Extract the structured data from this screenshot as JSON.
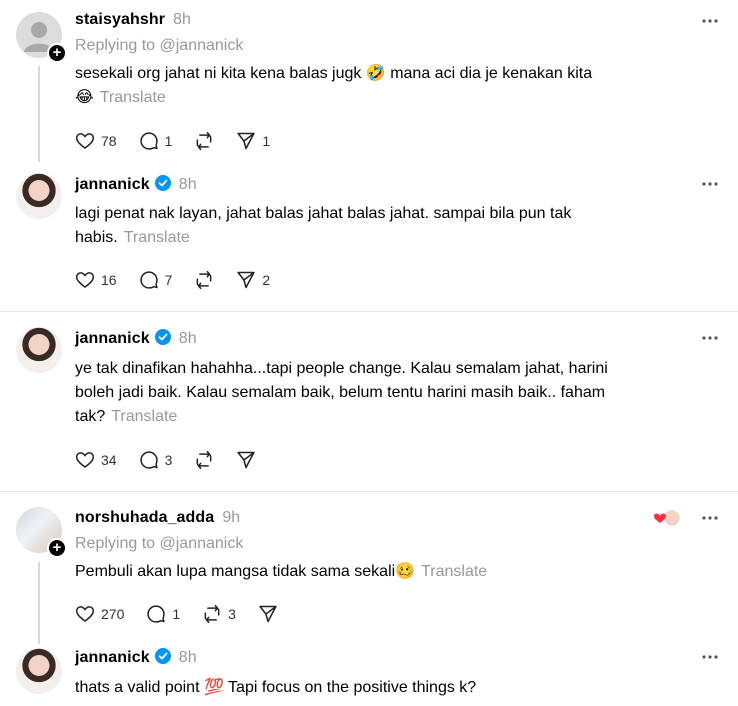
{
  "posts": [
    {
      "username": "staisyahshr",
      "time": "8h",
      "replying": "Replying to @jannanick",
      "text_line1": "sesekali org jahat ni kita kena balas jugk 🤣 mana aci dia je kenakan kita",
      "text_line2": "😂",
      "translate": "Translate",
      "likes": "78",
      "replies": "1",
      "shares": "1"
    },
    {
      "username": "jannanick",
      "time": "8h",
      "text_line1": "lagi penat nak layan, jahat balas jahat balas jahat. sampai bila pun tak",
      "text_line2": "habis.",
      "translate": "Translate",
      "likes": "16",
      "replies": "7",
      "shares": "2"
    },
    {
      "username": "jannanick",
      "time": "8h",
      "text_line1": "ye tak dinafikan hahahha...tapi people change. Kalau semalam jahat, harini",
      "text_line2": "boleh jadi baik. Kalau semalam baik, belum tentu harini masih baik.. faham",
      "text_line3": "tak?",
      "translate": "Translate",
      "likes": "34",
      "replies": "3"
    },
    {
      "username": "norshuhada_adda",
      "time": "9h",
      "replying": "Replying to @jannanick",
      "text_line1": "Pembuli akan lupa mangsa tidak sama sekali🥴",
      "translate": "Translate",
      "likes": "270",
      "replies": "1",
      "reposts": "3"
    },
    {
      "username": "jannanick",
      "time": "8h",
      "text_line1": "thats a valid point 💯 Tapi focus on the positive things k?"
    }
  ],
  "colors": {
    "verified": "#0095f6",
    "muted": "#999999",
    "divider": "#e5e5e5",
    "heart": "#ff3040"
  }
}
